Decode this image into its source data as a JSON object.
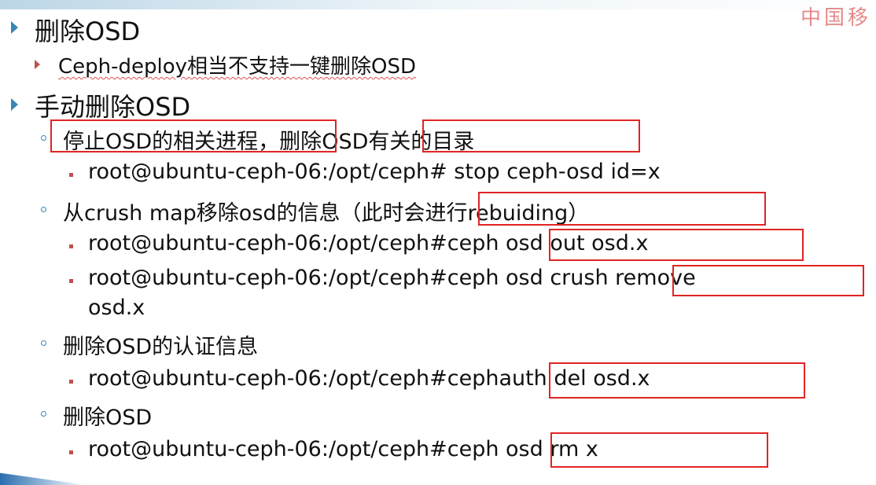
{
  "slide": {
    "logo": "中国移",
    "items": {
      "h1": "删除OSD",
      "h1_sub": "Ceph-deploy相当不支持一键删除OSD",
      "h2": "手动删除OSD",
      "s1": {
        "part_a": "停止OSD的相关进程",
        "sep": "，删除",
        "part_b": "OSD有关的目录"
      },
      "c1": "root@ubuntu-ceph-06:/opt/ceph# stop ceph-osd  id=x",
      "s2": {
        "prefix": "从crush map移除osd的信息（",
        "boxed": "此时会进行rebuiding",
        "suffix": "）"
      },
      "c2": {
        "prefix": "root@ubuntu-ceph-06:/opt/ceph#",
        "boxed": "ceph osd out osd.x"
      },
      "c3": {
        "prefix": "root@ubuntu-ceph-06:/opt/ceph#ceph osd ",
        "boxed": "crush remove",
        "cont": "osd.x"
      },
      "s3": "删除OSD的认证信息",
      "c4": {
        "prefix": "root@ubuntu-ceph-06:/opt/ceph#",
        "boxed": "cephauth del osd.x"
      },
      "s4": "删除OSD",
      "c5": {
        "prefix": "root@ubuntu-ceph-06:/opt/ceph#",
        "boxed": "ceph osd  rm   x"
      }
    }
  }
}
